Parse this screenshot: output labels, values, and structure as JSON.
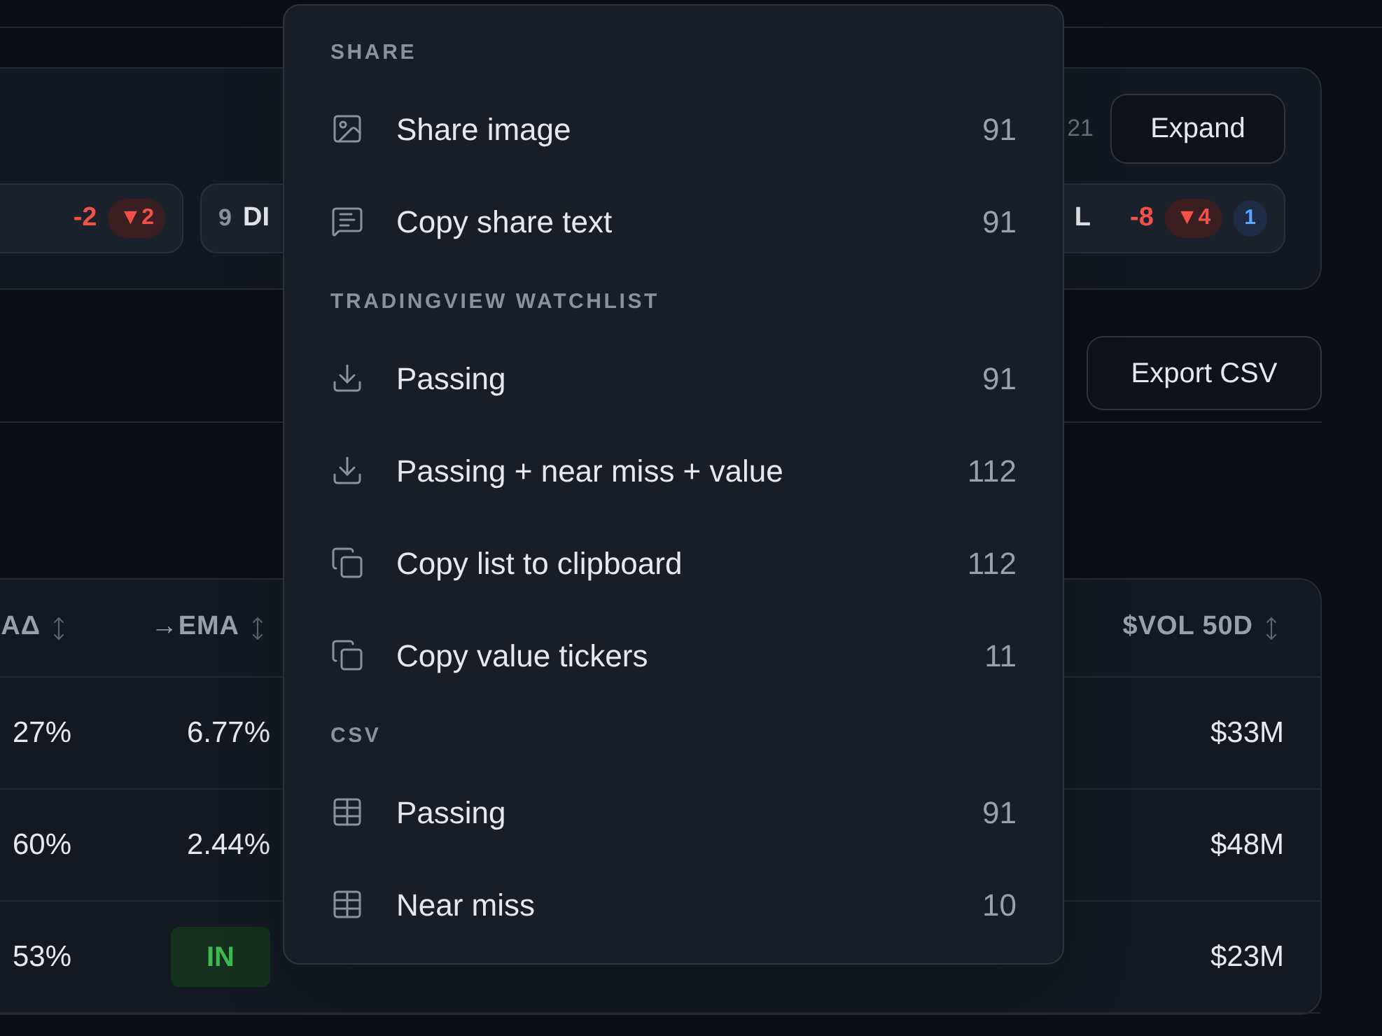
{
  "summary": {
    "count": "21",
    "expand_button": "Expand",
    "chips": [
      {
        "value": "-2",
        "down": "▼2"
      },
      {
        "count": "9",
        "label": "DI"
      },
      {
        "label": "L",
        "value": "-8",
        "down": "▼4",
        "info": "1"
      }
    ]
  },
  "export_button": "Export CSV",
  "table": {
    "columns": [
      "AΔ",
      "→EMA",
      "$VOL 50D"
    ],
    "rows": [
      {
        "cells": [
          {
            "kind": "text",
            "text": "27%"
          },
          {
            "kind": "text",
            "text": "6.77%"
          },
          {
            "kind": "text",
            "text": "$33M"
          }
        ]
      },
      {
        "cells": [
          {
            "kind": "text",
            "text": "60%"
          },
          {
            "kind": "text",
            "text": "2.44%"
          },
          {
            "kind": "text",
            "text": "$48M"
          }
        ]
      },
      {
        "cells": [
          {
            "kind": "text",
            "text": "53%"
          },
          {
            "kind": "badge",
            "text": "IN"
          },
          {
            "kind": "text",
            "text": "$23M"
          }
        ]
      }
    ]
  },
  "menu": {
    "sections": [
      {
        "title": "SHARE",
        "items": [
          {
            "kind": "image",
            "label": "Share image",
            "count": "91"
          },
          {
            "kind": "message",
            "label": "Copy share text",
            "count": "91"
          }
        ]
      },
      {
        "title": "TRADINGVIEW WATCHLIST",
        "items": [
          {
            "kind": "download",
            "label": "Passing",
            "count": "91"
          },
          {
            "kind": "download",
            "label": "Passing + near miss + value",
            "count": "112"
          },
          {
            "kind": "copy",
            "label": "Copy list to clipboard",
            "count": "112"
          },
          {
            "kind": "copy",
            "label": "Copy value tickers",
            "count": "11"
          }
        ]
      },
      {
        "title": "CSV",
        "items": [
          {
            "kind": "table",
            "label": "Passing",
            "count": "91"
          },
          {
            "kind": "table",
            "label": "Near miss",
            "count": "10"
          }
        ]
      }
    ]
  }
}
